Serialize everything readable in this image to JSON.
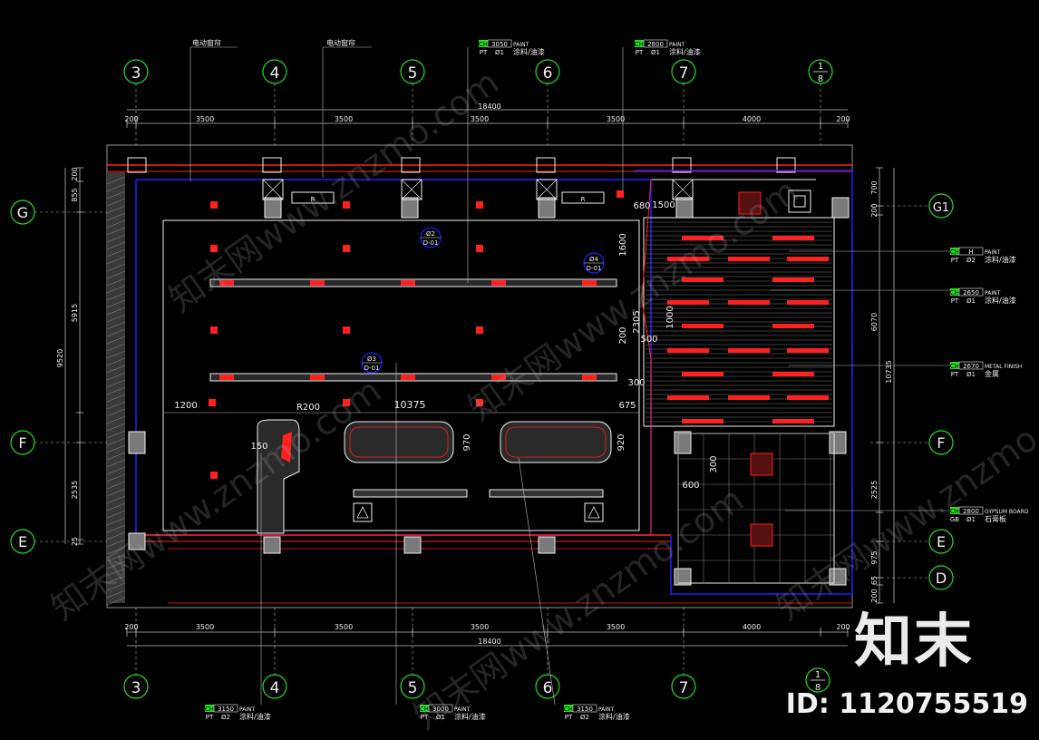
{
  "grid_top": [
    "3",
    "4",
    "5",
    "6",
    "7"
  ],
  "grid_top_last": {
    "num": "1",
    "den": "8"
  },
  "grid_right": [
    "G1",
    "F",
    "E",
    "D"
  ],
  "grid_left": [
    "G",
    "F",
    "E"
  ],
  "dims_top": [
    "200",
    "3500",
    "3500",
    "3500",
    "3500",
    "4000",
    "200"
  ],
  "dims_total": "18400",
  "dims_left": [
    "200",
    "855",
    "5915",
    "2535",
    "9520",
    "25"
  ],
  "dims_right": [
    "700",
    "200",
    "6070",
    "10735",
    "2525",
    "975",
    "65",
    "200"
  ],
  "dims_inner": [
    "1200",
    "10375",
    "675",
    "R200",
    "150",
    "970",
    "920",
    "680",
    "1500",
    "1600",
    "2305",
    "200",
    "500",
    "1000",
    "300",
    "600",
    "300"
  ],
  "notes": {
    "curtain1": "电动窗帘",
    "curtain2": "电动窗帘"
  },
  "tags": [
    {
      "ch": "3050",
      "pt": "Ø1",
      "en": "PAINT",
      "cn": "涂料/油漆"
    },
    {
      "ch": "2800",
      "pt": "Ø1",
      "en": "PAINT",
      "cn": "涂料/油漆"
    },
    {
      "ch": "H",
      "pt": "Ø2",
      "en": "PAINT",
      "cn": "涂料/油漆"
    },
    {
      "ch": "2650",
      "pt": "Ø1",
      "en": "PAINT",
      "cn": "涂料/油漆"
    },
    {
      "ch": "2670",
      "pt": "Ø1",
      "en": "METAL FINISH",
      "cn": "金属"
    },
    {
      "ch": "2800",
      "pt": "Ø1",
      "en": "GYPSUM BOARD",
      "cn": "石膏板"
    },
    {
      "ch": "3150",
      "pt": "Ø2",
      "en": "PAINT",
      "cn": "涂料/油漆"
    },
    {
      "ch": "3000",
      "pt": "Ø1",
      "en": "PAINT",
      "cn": "涂料/油漆"
    },
    {
      "ch": "3150",
      "pt": "Ø2",
      "en": "PAINT",
      "cn": "涂料/油漆"
    }
  ],
  "tag_labels": {
    "ch": "CH",
    "pt": "PT",
    "gb": "GB"
  },
  "section_marks": [
    {
      "top": "Ø2",
      "bottom": "D-01"
    },
    {
      "top": "Ø4",
      "bottom": "D-01"
    },
    {
      "top": "Ø3",
      "bottom": "D-01"
    }
  ],
  "brand": "知末",
  "id_label": "ID: 1120755519",
  "watermark": "知末网www.znzmo.com",
  "colors": {
    "bg": "#000000",
    "red": "#ff2020",
    "blue": "#2020ff",
    "green": "#20e020",
    "grid": "#bbbbbb",
    "grey": "#7a7a7a",
    "white": "#f0f0f0"
  }
}
